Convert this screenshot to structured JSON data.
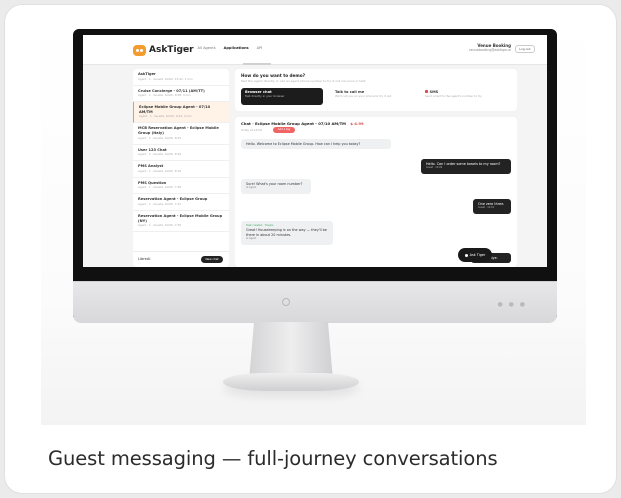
{
  "caption": "Guest messaging — full-journey conversations",
  "screen": {
    "brand": "AskTiger",
    "nav": [
      "Admin",
      "All Agents",
      "Applications",
      "API"
    ],
    "user": {
      "name": "Venue Booking",
      "email": "venuebooking@asktiger.ai",
      "button": "Log out"
    },
    "sidebar": {
      "conversations": [
        {
          "title": "AskTiger",
          "meta": "Agent · 1 · Guests, Smith, 13:41, 1 min"
        },
        {
          "title": "Cruise Concierge - 07/11 (AM/TT)",
          "meta": "Agent · 1 · Guests, Smith, 9:58, 3 min"
        },
        {
          "title": "Eclipse Mobile Group Agent - 07/10 AM/TM",
          "meta": "Agent · 1 · Guests, Smith, 9:24, 4 min"
        },
        {
          "title": "MCB Reservation Agent - Eclipse Mobile Group (Italy)",
          "meta": "Agent · 1 · Guests, Smith, 8:45"
        },
        {
          "title": "User 123 Chat",
          "meta": "Agent · 1 · Guests, Smith, 8:20"
        },
        {
          "title": "PMS Analyst",
          "meta": "Agent · 1 · Guests, Smith, 8:10"
        },
        {
          "title": "PMS Question",
          "meta": "Agent · 1 · Guests, Smith, 7:58"
        },
        {
          "title": "Reservation Agent - Eclipse Group",
          "meta": "Agent · 1 · Guests, Smith, 7:41"
        },
        {
          "title": "Reservation Agent - Eclipse Mobile Group (NY)",
          "meta": "Agent · 1 · Guests, Smith, 7:30"
        }
      ],
      "footer_label": "LibreAI",
      "footer_button": "New chat"
    },
    "prompt": {
      "title": "How do you want to demo?",
      "subtitle": "Test the Agent directly or call an agent phone number to try it out via voice or text.",
      "options": [
        {
          "title": "Browser chat",
          "desc": "Test directly in your browser"
        },
        {
          "title": "Talk to call me",
          "desc": "We'll call you on your phone to try it out"
        },
        {
          "title": "SMS",
          "desc": "Send a text to the agent's number to try"
        }
      ]
    },
    "chat": {
      "header": "Chat · Eclipse Mobile Group Agent - 07/10 AM/TM",
      "price": "$ 4.99",
      "meta": "Today at 14:08",
      "pill": "Add a tag",
      "messages": [
        {
          "from": "in",
          "text": "Hello. Welcome to Eclipse Mobile Group. How can I help you today?",
          "time": ""
        },
        {
          "from": "out",
          "text": "Hello. Can I order some towels to my room?",
          "time": "Guest · 14:09"
        },
        {
          "from": "in",
          "text": "Sure! What's your room number?",
          "time": "AI Agent"
        },
        {
          "from": "out",
          "text": "One zero three.",
          "time": "Guest · 14:10"
        },
        {
          "from": "in",
          "label": "Task created · Towels",
          "text": "Great! Housekeeping is on the way — they'll be there in about 20 minutes.",
          "time": "AI Agent"
        },
        {
          "from": "out",
          "text": "Thanks. Bye.",
          "time": ""
        }
      ],
      "fab": "Ask Tiger"
    }
  }
}
